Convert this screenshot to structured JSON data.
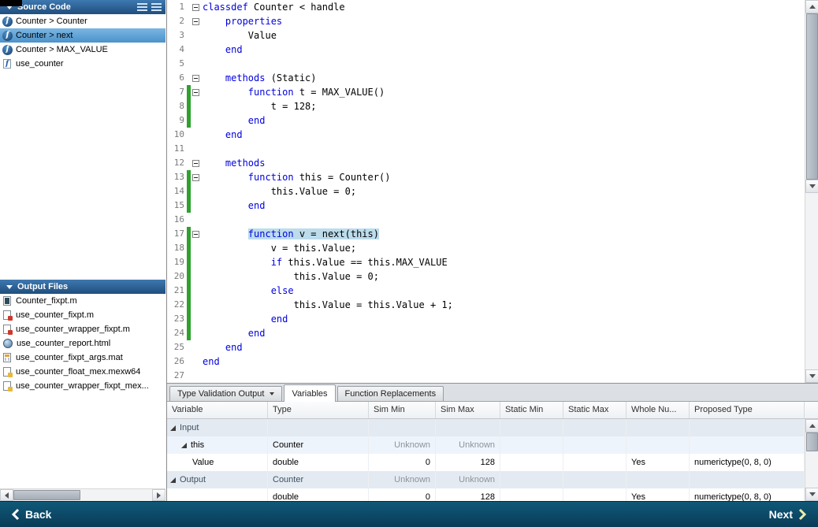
{
  "sidebar": {
    "source_code": {
      "title": "Source Code",
      "items": [
        {
          "label": "Counter > Counter",
          "icon": "function-icon",
          "selected": false
        },
        {
          "label": "Counter > next",
          "icon": "function-icon",
          "selected": true
        },
        {
          "label": "Counter > MAX_VALUE",
          "icon": "function-icon",
          "selected": false
        },
        {
          "label": "use_counter",
          "icon": "script-icon",
          "selected": false
        }
      ]
    },
    "output_files": {
      "title": "Output Files",
      "items": [
        {
          "label": "Counter_fixpt.m",
          "icon": "mfile-dark-icon"
        },
        {
          "label": "use_counter_fixpt.m",
          "icon": "mfile-red-icon"
        },
        {
          "label": "use_counter_wrapper_fixpt.m",
          "icon": "mfile-red-icon"
        },
        {
          "label": "use_counter_report.html",
          "icon": "html-icon"
        },
        {
          "label": "use_counter_fixpt_args.mat",
          "icon": "mat-icon"
        },
        {
          "label": "use_counter_float_mex.mexw64",
          "icon": "mex-icon"
        },
        {
          "label": "use_counter_wrapper_fixpt_mex...",
          "icon": "mex-icon"
        }
      ]
    }
  },
  "editor": {
    "lines": [
      {
        "n": 1,
        "fold": true,
        "segs": [
          [
            "k",
            "classdef"
          ],
          [
            "p",
            " Counter < handle"
          ]
        ]
      },
      {
        "n": 2,
        "fold": true,
        "segs": [
          [
            "p",
            "    "
          ],
          [
            "k",
            "properties"
          ]
        ]
      },
      {
        "n": 3,
        "segs": [
          [
            "p",
            "        Value"
          ]
        ]
      },
      {
        "n": 4,
        "segs": [
          [
            "p",
            "    "
          ],
          [
            "k",
            "end"
          ]
        ]
      },
      {
        "n": 5,
        "segs": []
      },
      {
        "n": 6,
        "fold": true,
        "segs": [
          [
            "p",
            "    "
          ],
          [
            "k",
            "methods"
          ],
          [
            "p",
            " (Static)"
          ]
        ]
      },
      {
        "n": 7,
        "fold": true,
        "cov": true,
        "segs": [
          [
            "p",
            "        "
          ],
          [
            "k",
            "function"
          ],
          [
            "p",
            " t = MAX_VALUE()"
          ]
        ]
      },
      {
        "n": 8,
        "cov": true,
        "segs": [
          [
            "p",
            "            t = 128;"
          ]
        ]
      },
      {
        "n": 9,
        "cov": true,
        "segs": [
          [
            "p",
            "        "
          ],
          [
            "k",
            "end"
          ]
        ]
      },
      {
        "n": 10,
        "segs": [
          [
            "p",
            "    "
          ],
          [
            "k",
            "end"
          ]
        ]
      },
      {
        "n": 11,
        "segs": []
      },
      {
        "n": 12,
        "fold": true,
        "segs": [
          [
            "p",
            "    "
          ],
          [
            "k",
            "methods"
          ]
        ]
      },
      {
        "n": 13,
        "fold": true,
        "cov": true,
        "segs": [
          [
            "p",
            "        "
          ],
          [
            "k",
            "function"
          ],
          [
            "p",
            " this = Counter()"
          ]
        ]
      },
      {
        "n": 14,
        "cov": true,
        "segs": [
          [
            "p",
            "            this.Value = 0;"
          ]
        ]
      },
      {
        "n": 15,
        "cov": true,
        "segs": [
          [
            "p",
            "        "
          ],
          [
            "k",
            "end"
          ]
        ]
      },
      {
        "n": 16,
        "segs": []
      },
      {
        "n": 17,
        "fold": true,
        "cov": true,
        "hl": true,
        "segs": [
          [
            "p",
            "        "
          ],
          [
            "k",
            "function"
          ],
          [
            "p",
            " v = next(this)"
          ]
        ]
      },
      {
        "n": 18,
        "cov": true,
        "segs": [
          [
            "p",
            "            v = this.Value;"
          ]
        ]
      },
      {
        "n": 19,
        "cov": true,
        "segs": [
          [
            "p",
            "            "
          ],
          [
            "k",
            "if"
          ],
          [
            "p",
            " this.Value == this.MAX_VALUE"
          ]
        ]
      },
      {
        "n": 20,
        "cov": true,
        "segs": [
          [
            "p",
            "                this.Value = 0;"
          ]
        ]
      },
      {
        "n": 21,
        "cov": true,
        "segs": [
          [
            "p",
            "            "
          ],
          [
            "k",
            "else"
          ]
        ]
      },
      {
        "n": 22,
        "cov": true,
        "segs": [
          [
            "p",
            "                this.Value = this.Value + 1;"
          ]
        ]
      },
      {
        "n": 23,
        "cov": true,
        "segs": [
          [
            "p",
            "            "
          ],
          [
            "k",
            "end"
          ]
        ]
      },
      {
        "n": 24,
        "cov": true,
        "segs": [
          [
            "p",
            "        "
          ],
          [
            "k",
            "end"
          ]
        ]
      },
      {
        "n": 25,
        "segs": [
          [
            "p",
            "    "
          ],
          [
            "k",
            "end"
          ]
        ]
      },
      {
        "n": 26,
        "segs": [
          [
            "k",
            "end"
          ]
        ]
      },
      {
        "n": 27,
        "segs": []
      }
    ]
  },
  "panel": {
    "tabs": [
      {
        "label": "Type Validation Output",
        "dropdown": true,
        "active": false
      },
      {
        "label": "Variables",
        "dropdown": false,
        "active": true
      },
      {
        "label": "Function Replacements",
        "dropdown": false,
        "active": false
      }
    ],
    "table": {
      "columns": [
        "Variable",
        "Type",
        "Sim Min",
        "Sim Max",
        "Static Min",
        "Static Max",
        "Whole Nu...",
        "Proposed Type"
      ],
      "rows": [
        {
          "type": "group",
          "name": "Input",
          "tri": true,
          "cells": [
            "",
            "",
            "",
            "",
            "",
            "",
            ""
          ]
        },
        {
          "type": "item",
          "name": "this",
          "indent": 1,
          "tri": true,
          "tint": true,
          "cells": [
            "Counter",
            "Unknown",
            "Unknown",
            "",
            "",
            "",
            ""
          ]
        },
        {
          "type": "item",
          "name": "Value",
          "indent": 2,
          "cells": [
            "double",
            "0",
            "128",
            "",
            "",
            "Yes",
            "numerictype(0, 8, 0)"
          ]
        },
        {
          "type": "group",
          "name": "Output",
          "tri": true,
          "cells": [
            "Counter",
            "Unknown",
            "Unknown",
            "",
            "",
            "",
            ""
          ]
        },
        {
          "type": "item",
          "name": "",
          "indent": 2,
          "cells": [
            "double",
            "0",
            "128",
            "",
            "",
            "Yes",
            "numerictype(0, 8, 0)"
          ]
        }
      ]
    }
  },
  "nav": {
    "back_label": "Back",
    "next_label": "Next"
  },
  "colors": {
    "keyword": "#0000E0",
    "coverage_green": "#2EA12E",
    "selection": "#BCDCEC",
    "header_top": "#3E78B0",
    "header_bottom": "#1F4E7D",
    "nav_top": "#0F5878",
    "nav_bottom": "#0A3C57",
    "selected_item": "#5FA3D6"
  }
}
